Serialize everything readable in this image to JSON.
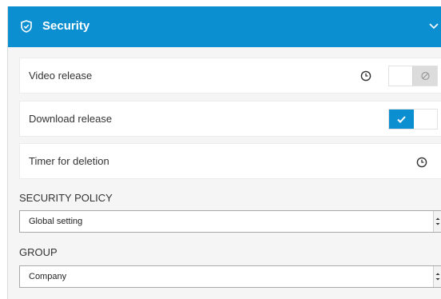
{
  "header": {
    "title": "Security",
    "icon": "shield-icon",
    "collapse_icon": "chevron-down-icon",
    "color": "#0b8fd1"
  },
  "rows": [
    {
      "label": "Video release",
      "toggle_state": "off",
      "has_clock": true
    },
    {
      "label": "Download release",
      "toggle_state": "on",
      "has_clock": false
    },
    {
      "label": "Timer for deletion",
      "has_clock": true
    }
  ],
  "security_policy": {
    "label": "SECURITY POLICY",
    "selected": "Global setting"
  },
  "group": {
    "label": "GROUP",
    "selected": "Company"
  }
}
